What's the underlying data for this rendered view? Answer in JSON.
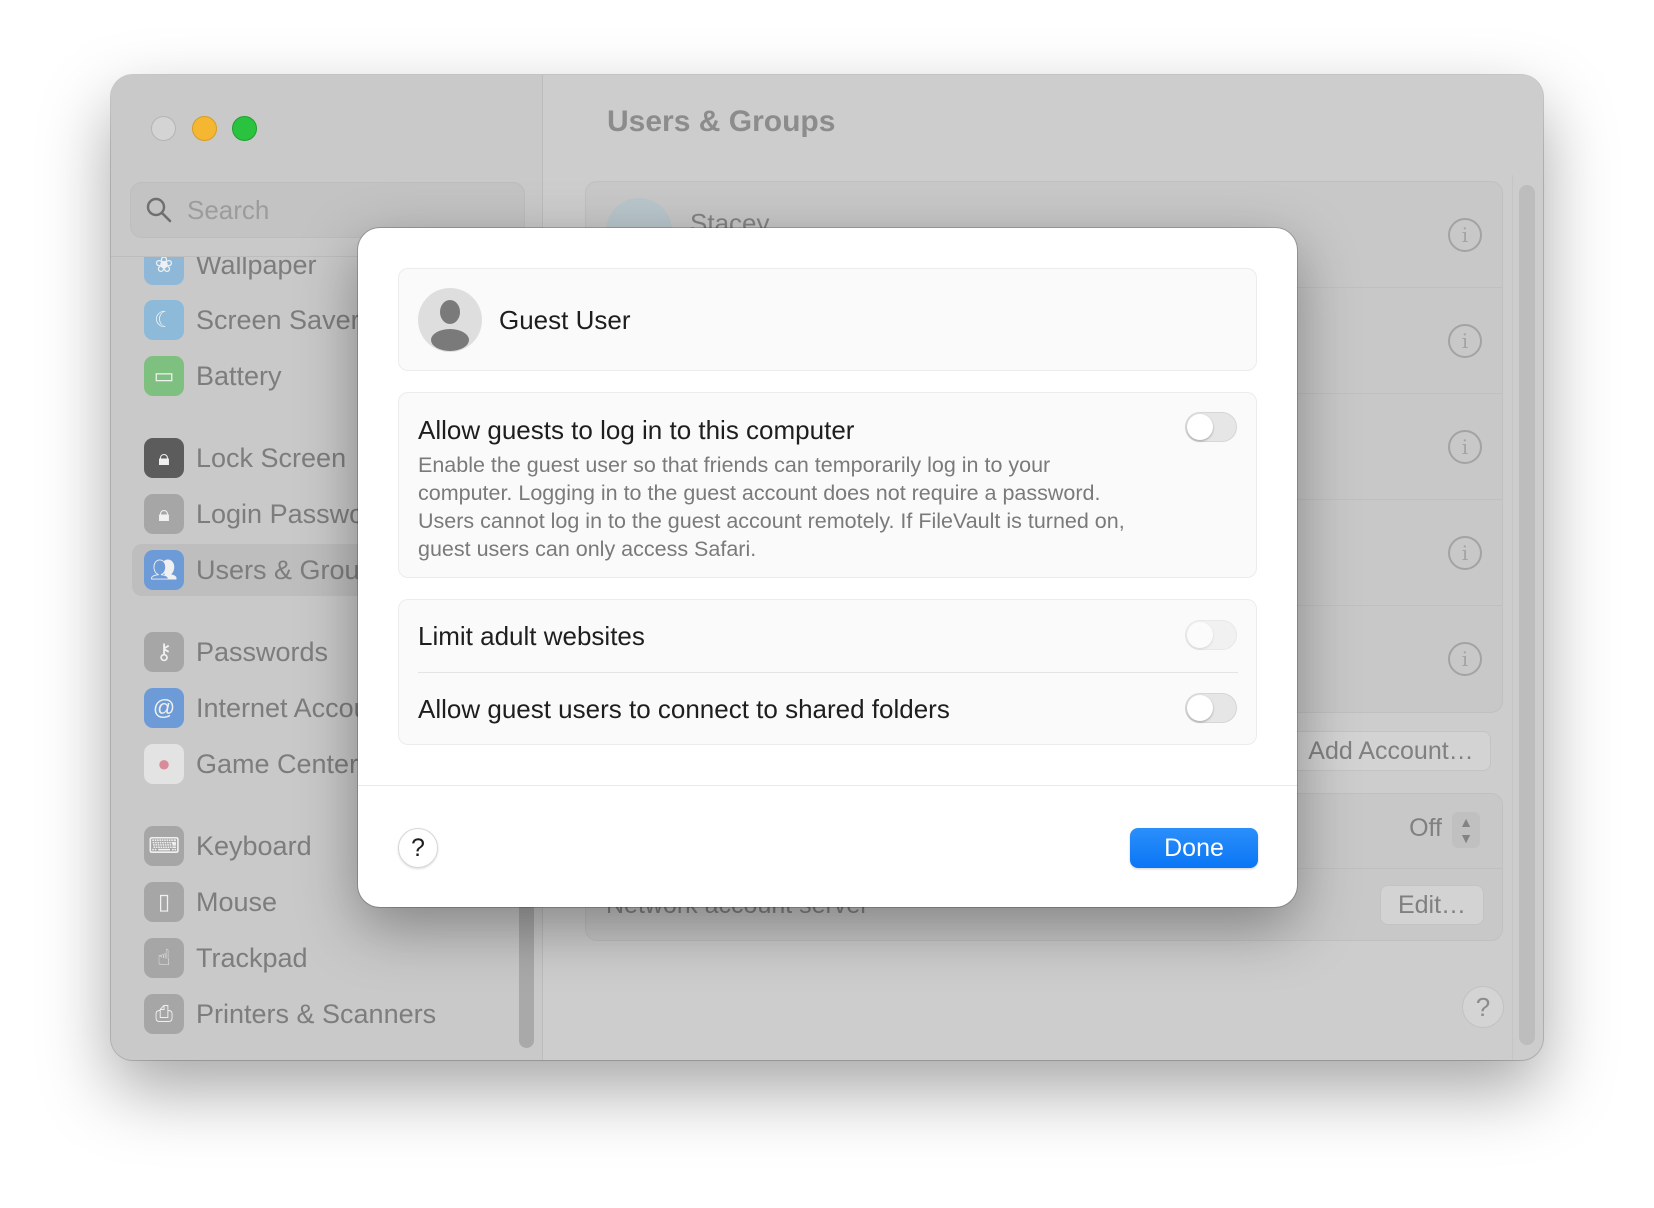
{
  "window": {
    "title": "Users & Groups",
    "traffic_lights": [
      "close",
      "minimize",
      "zoom"
    ]
  },
  "sidebar": {
    "search_placeholder": "Search",
    "items": [
      {
        "label": "Wallpaper",
        "icon": "wallpaper-icon",
        "color": "#8fb8d8",
        "glyph": "❀"
      },
      {
        "label": "Screen Saver",
        "icon": "screen-saver-icon",
        "color": "#8dbad9",
        "glyph": "☾"
      },
      {
        "label": "Battery",
        "icon": "battery-icon",
        "color": "#7dc07f",
        "glyph": "▭"
      },
      {
        "label": "Lock Screen",
        "icon": "lock-screen-icon",
        "color": "#5c5c5c",
        "glyph": "🔒︎"
      },
      {
        "label": "Login Password",
        "icon": "login-password-icon",
        "color": "#a6a6a6",
        "glyph": "🔒︎"
      },
      {
        "label": "Users & Groups",
        "icon": "users-groups-icon",
        "color": "#6d9bd8",
        "glyph": "👥︎",
        "selected": true
      },
      {
        "label": "Passwords",
        "icon": "passwords-icon",
        "color": "#a6a6a6",
        "glyph": "⚷"
      },
      {
        "label": "Internet Accounts",
        "icon": "internet-accounts-icon",
        "color": "#6d9bd8",
        "glyph": "@"
      },
      {
        "label": "Game Center",
        "icon": "game-center-icon",
        "color": "#e3e3e3",
        "glyph": "●"
      },
      {
        "label": "Keyboard",
        "icon": "keyboard-icon",
        "color": "#a6a6a6",
        "glyph": "⌨"
      },
      {
        "label": "Mouse",
        "icon": "mouse-icon",
        "color": "#a6a6a6",
        "glyph": "▯"
      },
      {
        "label": "Trackpad",
        "icon": "trackpad-icon",
        "color": "#a6a6a6",
        "glyph": "☝"
      },
      {
        "label": "Printers & Scanners",
        "icon": "printers-scanners-icon",
        "color": "#a6a6a6",
        "glyph": "⎙"
      }
    ]
  },
  "main": {
    "title": "Users & Groups",
    "users": [
      {
        "name": "Stacey"
      },
      {
        "name": ""
      },
      {
        "name": ""
      },
      {
        "name": ""
      },
      {
        "name": ""
      }
    ],
    "add_account_label": "Add Account…",
    "auto_login_value": "Off",
    "network_server_label": "Network account server",
    "edit_label": "Edit…",
    "help_label": "?"
  },
  "dialog": {
    "user_name": "Guest User",
    "allow_title": "Allow guests to log in to this computer",
    "allow_description": "Enable the guest user so that friends can temporarily log in to your computer. Logging in to the guest account does not require a password. Users cannot log in to the guest account remotely. If FileVault is turned on, guest users can only access Safari.",
    "allow_enabled": false,
    "options": [
      {
        "label": "Limit adult websites",
        "enabled": false,
        "disabled": true
      },
      {
        "label": "Allow guest users to connect to shared folders",
        "enabled": false,
        "disabled": false
      }
    ],
    "help_label": "?",
    "done_label": "Done",
    "accent_color": "#0a76f5"
  }
}
